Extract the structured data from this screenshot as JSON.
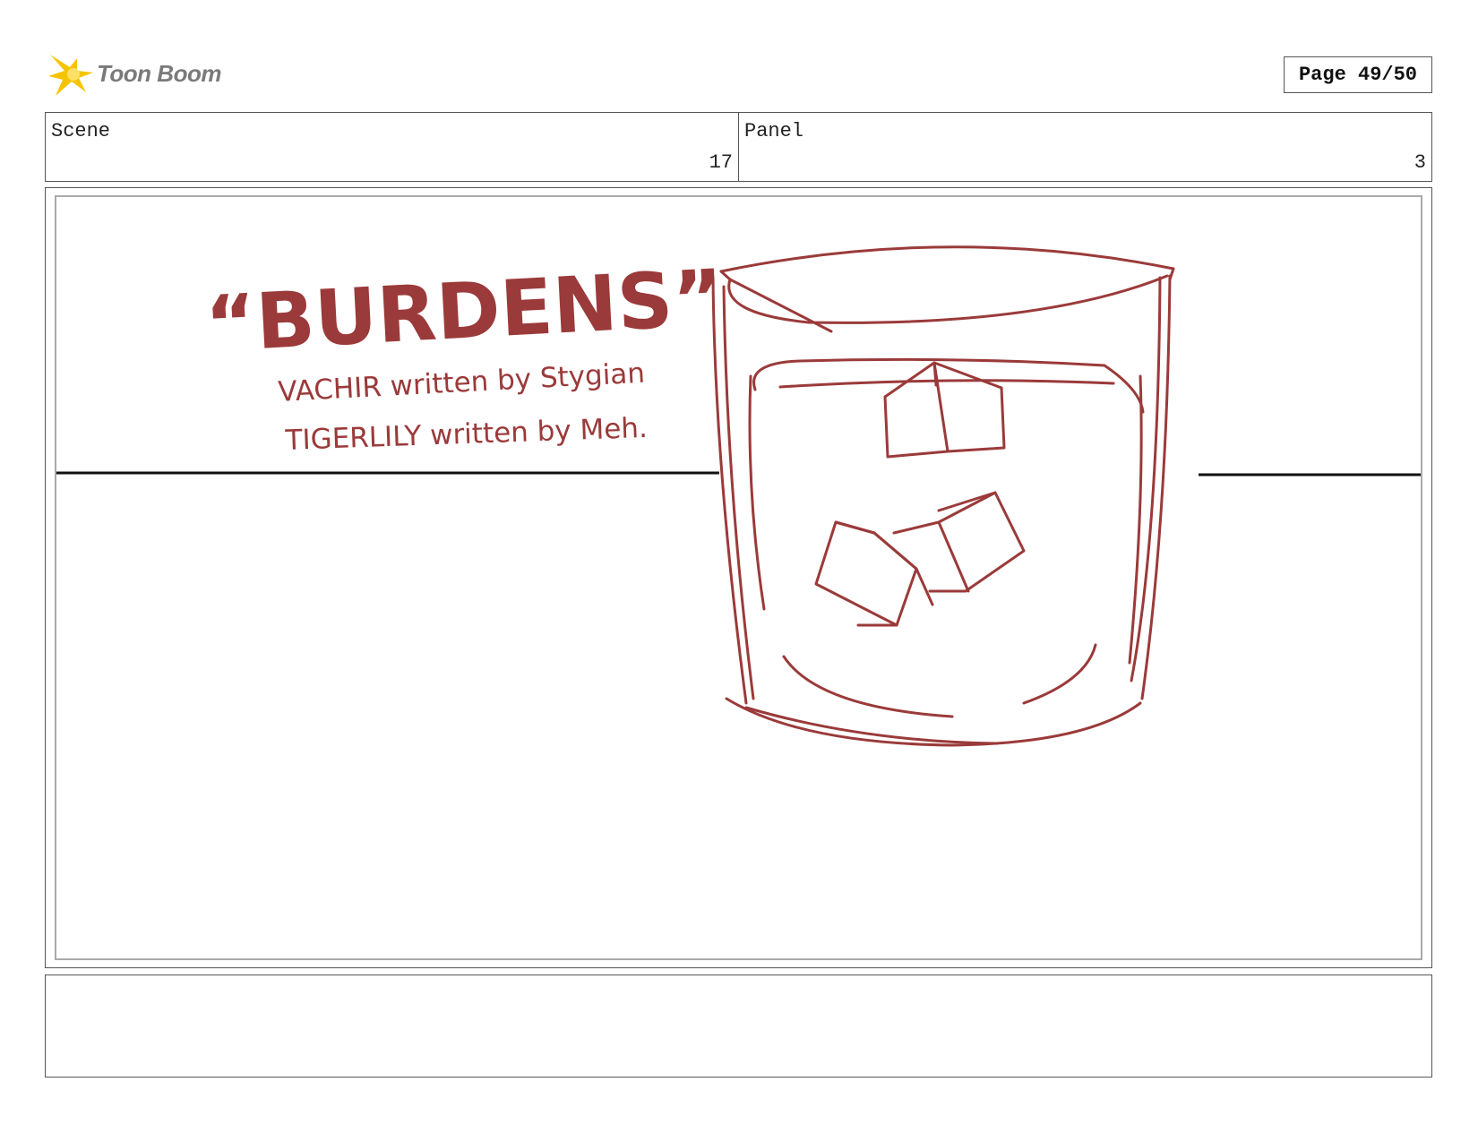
{
  "header": {
    "logo_text": "Toon Boom",
    "page_label": "Page 49/50"
  },
  "info": {
    "scene_label": "Scene",
    "scene_value": "17",
    "panel_label": "Panel",
    "panel_value": "3"
  },
  "drawing": {
    "title_text": "“BURDENS”",
    "credit_line_1": "VACHIR written by Stygian",
    "credit_line_2": "TIGERLILY written by Meh.",
    "ink_color": "#9b3a3a"
  },
  "notes": {
    "text": ""
  }
}
